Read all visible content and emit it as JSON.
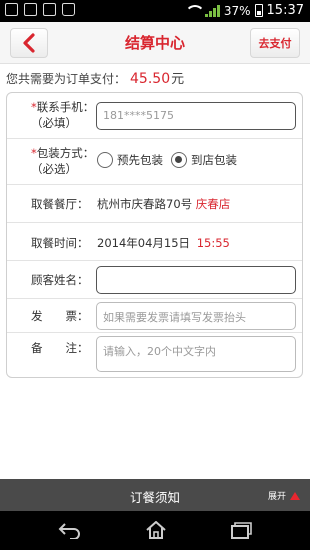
{
  "status_bar": {
    "battery": "37%",
    "time": "15:37"
  },
  "header": {
    "title": "结算中心",
    "pay_label": "去支付"
  },
  "summary": {
    "prefix": "您共需要为订单支付：",
    "amount": "45.50",
    "unit": "元"
  },
  "form": {
    "phone": {
      "label": "*联系手机：",
      "hint": "（必填）",
      "value": "181****5175"
    },
    "packing": {
      "label": "*包装方式：",
      "hint": "（必选）",
      "options": [
        "预先包装",
        "到店包装"
      ],
      "selected": "到店包装"
    },
    "restaurant": {
      "label": "取餐餐厅：",
      "address": "杭州市庆春路70号",
      "branch": "庆春店"
    },
    "pickup_time": {
      "label": "取餐时间：",
      "date": "2014年04月15日",
      "time": "15:55"
    },
    "customer_name": {
      "label": "顾客姓名：",
      "value": ""
    },
    "invoice": {
      "label": "发　　票：",
      "placeholder": "如果需要发票请填写发票抬头"
    },
    "remark": {
      "label": "备　　注：",
      "placeholder": "请输入，20个中文字内"
    }
  },
  "notice": {
    "title": "订餐须知",
    "expand_label": "展开"
  },
  "colors": {
    "accent": "#d9262f",
    "notice_bar": "#4a4a4a"
  }
}
